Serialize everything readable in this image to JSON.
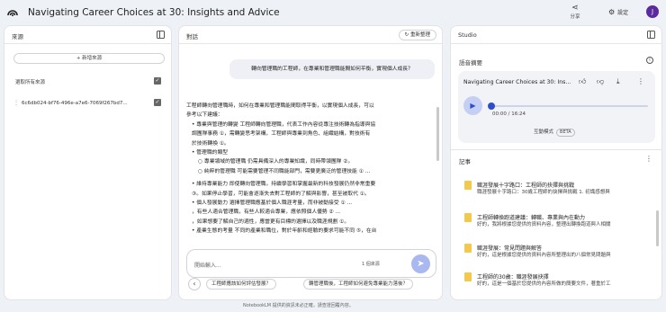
{
  "header": {
    "title": "Navigating Career Choices at 30: Insights and Advice",
    "share_label": "分享",
    "settings_label": "設定",
    "avatar_initial": "J"
  },
  "sources": {
    "title": "來源",
    "add_label": "+ 新增來源",
    "select_all_label": "選取所有來源",
    "items": [
      {
        "name": "6c6db024-bf76-496e-a7e6-7069f267bd7..."
      }
    ]
  },
  "chat": {
    "title": "對話",
    "refresh_label": "重新整理",
    "user_message": "轉向管理職的工程師，在專業和管理職能間如何平衡，實現個人成長？",
    "answer_lines": [
      {
        "text": "工程師轉向管理職時，如何在專業和管理職能間取得平衡，以實現個人成長，可以",
        "indent": 0
      },
      {
        "text": "參考以下建議：",
        "indent": 0
      },
      {
        "text": "• 專業與管理的轉變 工程師轉向管理職，代表工作內容從專注技術轉為指導與協",
        "indent": 1
      },
      {
        "text": "調團隊事務 ①，需轉變思考架構，工程師與專業到角色、組織結構，對技術有",
        "indent": 1
      },
      {
        "text": "於技術轉換 ①。",
        "indent": 1
      },
      {
        "text": "• 管理職的類型",
        "indent": 1
      },
      {
        "text": "○ 專業領域的管理職 仍需具備深入的專業知識，同時帶領團隊 ②。",
        "indent": 2
      },
      {
        "text": "○ 純粹的管理職 可能需要管理不同職能部門，需要更廣泛的管理技能 ① ...",
        "indent": 2
      },
      {
        "text": "",
        "indent": 0
      },
      {
        "text": "• 維持專業能力 即使轉向管理職，持續學習和掌握最新的科技發展仍然非常重要",
        "indent": 1
      },
      {
        "text": "③。如果停止學習，可能會逐漸失去對工程師的了解與影響，甚至被取代 ①。",
        "indent": 1
      },
      {
        "text": "• 個人發展動力 選擇管理職應基於個人職涯考量，而非被動接受 ① ...",
        "indent": 1
      },
      {
        "text": "，有些人適合管理職，有些人較適合專業，應依照個人優勢 ② ...",
        "indent": 1
      },
      {
        "text": "，如果想要了解自己的適性，應當更有目標的選擇以及職涯規劃 ①。",
        "indent": 1
      },
      {
        "text": "• 產業生態的考量 不同的產業和職位，對於年齡和經驗的要求可能不同 ⑤，在台",
        "indent": 1
      }
    ],
    "input_placeholder": "開始輸入...",
    "source_count": "1 個來源",
    "suggestions": [
      "工程師應該如何評估發展？",
      "轉管理職後，工程師如何避免專業能力落後？"
    ],
    "footer": "NotebookLM 提供的資訊未必正確，請查證回覆內容。"
  },
  "studio": {
    "title": "Studio",
    "audio_header": "語音摘要",
    "audio_title": "Navigating Career Choices at 30: Ins...",
    "time_label": "00:00 / 16:24",
    "interactive_label": "互動模式",
    "beta_label": "BETA",
    "notes_header": "記事",
    "notes": [
      {
        "title": "職涯發展十字路口：工程師的抉擇與挑戰",
        "body": "職涯發展十字路口：30歲工程師的抉擇與挑戰 1. 初識感想與"
      },
      {
        "title": "工程師轉換跑道建議：轉職、專業與內在動力",
        "body": "好的，我將根據您提供的資料內容，整理出轉換跑道與人相關"
      },
      {
        "title": "職涯發展：常見問題與解答",
        "body": "好的，這是根據您提供的資料內容所整理出的八個常見問題與"
      },
      {
        "title": "工程師的30歲：職涯發展抉擇",
        "body": "好的，這是一個基於您提供的內容所做的簡要文件，著重於工"
      }
    ]
  }
}
